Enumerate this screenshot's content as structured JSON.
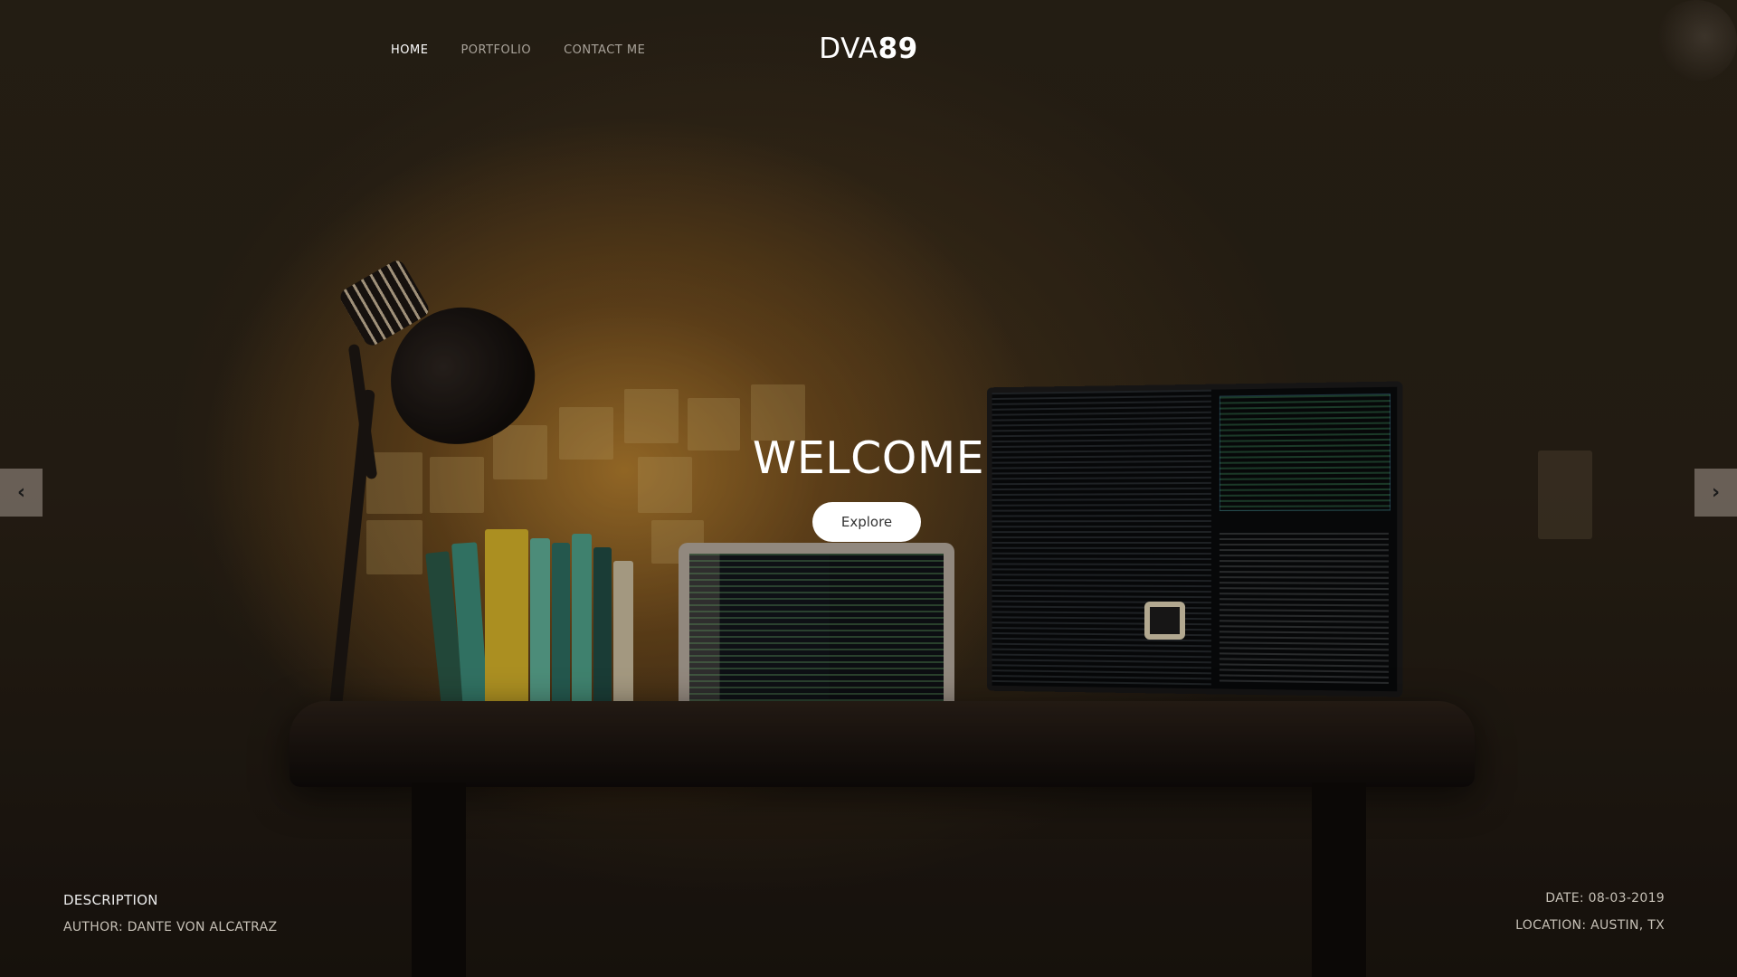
{
  "nav": {
    "items": [
      {
        "label": "HOME",
        "active": true
      },
      {
        "label": "PORTFOLIO",
        "active": false
      },
      {
        "label": "CONTACT ME",
        "active": false
      }
    ]
  },
  "brand": {
    "light": "DVA",
    "bold": "89"
  },
  "hero": {
    "title": "WELCOME",
    "button_label": "Explore"
  },
  "carousel": {
    "prev_icon": "chevron-left-icon",
    "next_icon": "chevron-right-icon",
    "prev_glyph": "‹",
    "next_glyph": "›"
  },
  "meta": {
    "description_label": "DESCRIPTION",
    "author": "AUTHOR: DANTE VON ALCATRAZ",
    "date": "DATE: 08-03-2019",
    "location": "LOCATION: AUSTIN, TX"
  },
  "colors": {
    "text_primary": "#ffffff",
    "nav_inactive": "#a9a39a",
    "button_bg": "#ffffff",
    "button_text": "#333333"
  }
}
